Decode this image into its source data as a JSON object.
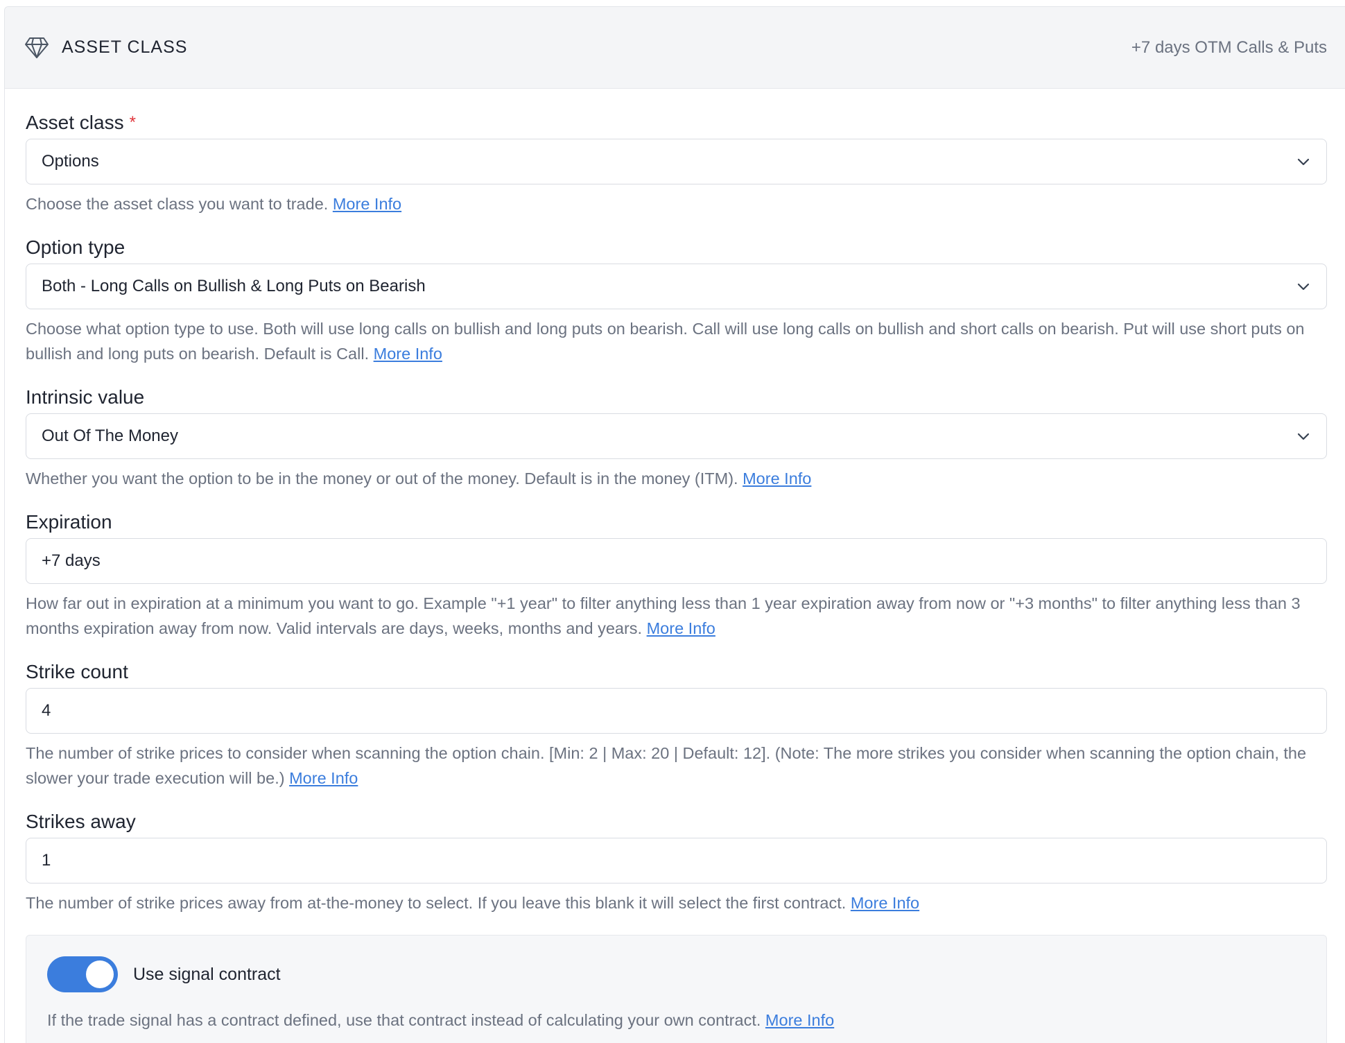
{
  "header": {
    "title": "ASSET CLASS",
    "summary": "+7 days OTM Calls & Puts",
    "icon": "diamond-icon"
  },
  "fields": {
    "asset_class": {
      "label": "Asset class",
      "required_mark": "*",
      "value": "Options",
      "help": "Choose the asset class you want to trade.",
      "link": "More Info"
    },
    "option_type": {
      "label": "Option type",
      "value": "Both - Long Calls on Bullish & Long Puts on Bearish",
      "help": "Choose what option type to use. Both will use long calls on bullish and long puts on bearish. Call will use long calls on bullish and short calls on bearish. Put will use short puts on bullish and long puts on bearish. Default is Call.",
      "link": "More Info"
    },
    "intrinsic_value": {
      "label": "Intrinsic value",
      "value": "Out Of The Money",
      "help": "Whether you want the option to be in the money or out of the money. Default is in the money (ITM).",
      "link": "More Info"
    },
    "expiration": {
      "label": "Expiration",
      "value": "+7 days",
      "help": "How far out in expiration at a minimum you want to go. Example \"+1 year\" to filter anything less than 1 year expiration away from now or \"+3 months\" to filter anything less than 3 months expiration away from now. Valid intervals are days, weeks, months and years.",
      "link": "More Info"
    },
    "strike_count": {
      "label": "Strike count",
      "value": "4",
      "help": "The number of strike prices to consider when scanning the option chain. [Min: 2 | Max: 20 | Default: 12]. (Note: The more strikes you consider when scanning the option chain, the slower your trade execution will be.)",
      "link": "More Info"
    },
    "strikes_away": {
      "label": "Strikes away",
      "value": "1",
      "help": "The number of strike prices away from at-the-money to select. If you leave this blank it will select the first contract.",
      "link": "More Info"
    }
  },
  "signal_contract": {
    "label": "Use signal contract",
    "enabled": true,
    "help": "If the trade signal has a contract defined, use that contract instead of calculating your own contract.",
    "link": "More Info"
  },
  "colors": {
    "accent": "#3b7ddd",
    "required": "#e0353b",
    "muted_text": "#6b7280"
  }
}
